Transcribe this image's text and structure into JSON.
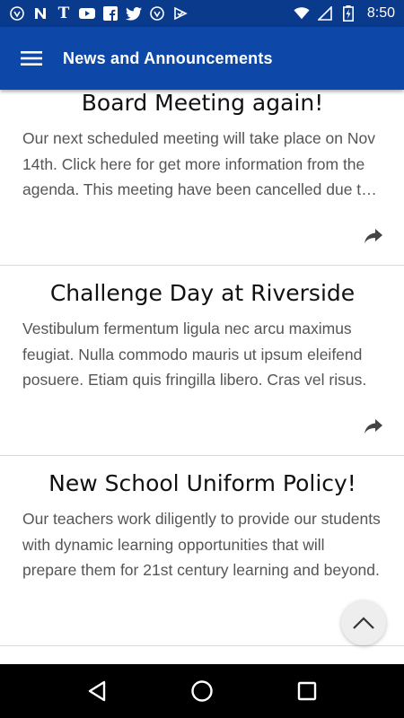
{
  "status_bar": {
    "time": "8:50",
    "left_icons": [
      "shield-icon",
      "n-icon",
      "nytimes-icon",
      "youtube-icon",
      "facebook-icon",
      "twitter-icon",
      "shield-icon",
      "checkmark-icon"
    ],
    "right_icons": [
      "wifi-icon",
      "signal-icon",
      "battery-charging-icon"
    ]
  },
  "app_bar": {
    "title": "News and Announcements",
    "menu_icon": "hamburger-menu-icon"
  },
  "articles": [
    {
      "title": "Board Meeting again!",
      "body": "Our next scheduled meeting will take place on Nov 14th. Click here for get more information from the agenda. This meeting have been cancelled due to weather."
    },
    {
      "title": "Challenge Day at Riverside",
      "body": "Vestibulum fermentum ligula nec arcu maximus feugiat. Nulla commodo mauris ut ipsum eleifend posuere. Etiam quis fringilla libero. Cras vel risus."
    },
    {
      "title": "New School Uniform Policy!",
      "body": "Our teachers work diligently to provide our students with dynamic learning opportunities that will prepare them for 21st century learning and beyond."
    }
  ],
  "colors": {
    "status_bar_bg": "#0a3a8c",
    "app_bar_bg": "#0d47a8",
    "title_text": "#111111",
    "body_text": "#555555",
    "divider": "#d9d9d9"
  }
}
